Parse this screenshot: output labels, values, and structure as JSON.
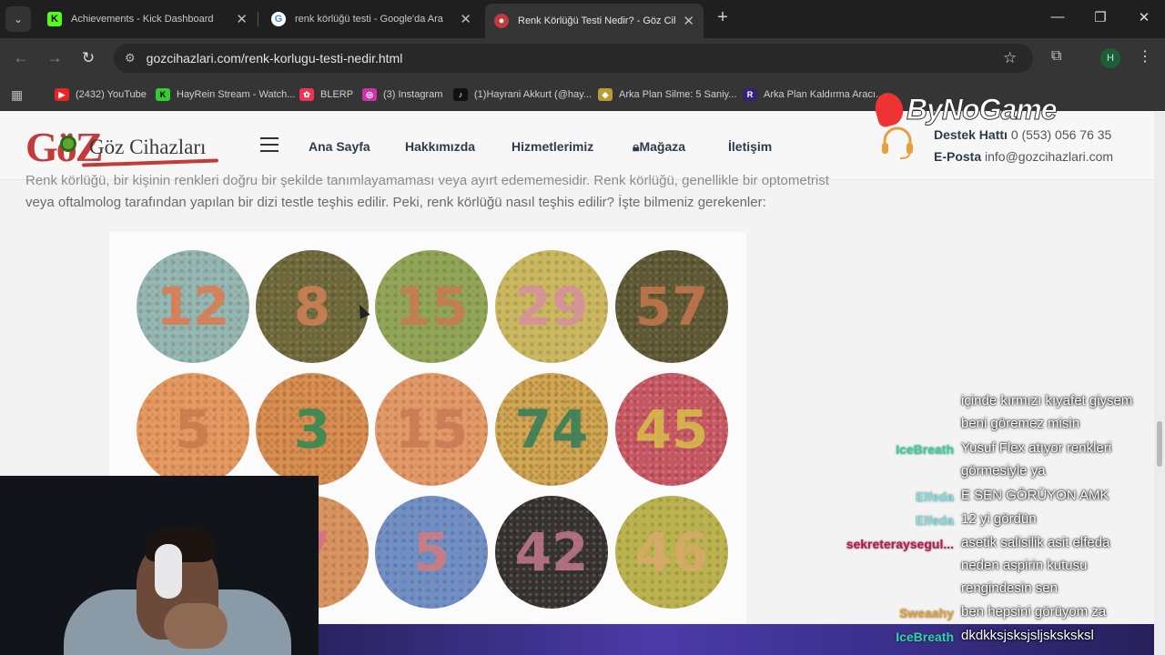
{
  "tabs": [
    {
      "title": "Achievements - Kick Dashboard",
      "icon": "kick-icon"
    },
    {
      "title": "renk körlüğü testi - Google'da Ara",
      "icon": "google-icon"
    },
    {
      "title": "Renk Körlüğü Testi Nedir? - Göz Cihaz",
      "icon": "site-icon",
      "active": true
    }
  ],
  "address": {
    "url": "gozcihazlari.com/renk-korlugu-testi-nedir.html"
  },
  "profile_initial": "H",
  "bookmarks": [
    {
      "label": "(2432) YouTube",
      "icon": "youtube-icon",
      "color": "#e22"
    },
    {
      "label": "HayRein Stream - Watch...",
      "icon": "kick-icon",
      "color": "#3c3"
    },
    {
      "label": "BLERP",
      "icon": "blerp-icon",
      "color": "#e35"
    },
    {
      "label": "(3) Instagram",
      "icon": "instagram-icon",
      "color": "#c3a"
    },
    {
      "label": "(1)Hayrani Akkurt (@hay...",
      "icon": "tiktok-icon",
      "color": "#111"
    },
    {
      "label": "Arka Plan Silme: 5 Saniy...",
      "icon": "removebg-icon",
      "color": "#b93"
    },
    {
      "label": "Arka Plan Kaldırma Aracı...",
      "icon": "remove-tool-icon",
      "color": "#327"
    }
  ],
  "site": {
    "logo_goz": "GöZ",
    "logo_word": "Göz Cihazları",
    "nav": [
      "Ana Sayfa",
      "Hakkımızda",
      "Hizmetlerimiz",
      "Mağaza",
      "İletişim"
    ],
    "support_label": "Destek Hattı",
    "support_phone": "0 (553) 056 76 35",
    "email_label": "E-Posta",
    "email": "info@gozcihazlari.com"
  },
  "article": {
    "line1": "Renk körlüğü, bir kişinin renkleri doğru bir şekilde tanımlayamaması veya ayırt edememesidir. Renk körlüğü, genellikle bir optometrist",
    "line2": "veya oftalmolog tarafından yapılan bir dizi testle teşhis edilir. Peki, renk körlüğü nasıl teşhis edilir? İşte bilmeniz gerekenler:"
  },
  "plates": [
    {
      "num": "12",
      "bg": "#8fbab7",
      "fg": "#e0794d"
    },
    {
      "num": "8",
      "bg": "#6b6a3c",
      "fg": "#d28057"
    },
    {
      "num": "15",
      "bg": "#8da857",
      "fg": "#c97a50"
    },
    {
      "num": "29",
      "bg": "#c9ba5c",
      "fg": "#d88fa0"
    },
    {
      "num": "57",
      "bg": "#5a5a36",
      "fg": "#c7774d"
    },
    {
      "num": "5",
      "bg": "#e69a62",
      "fg": "#c57c4c"
    },
    {
      "num": "3",
      "bg": "#e28b4f",
      "fg": "#2b8a54"
    },
    {
      "num": "15",
      "bg": "#e49a67",
      "fg": "#c87a55"
    },
    {
      "num": "74",
      "bg": "#d7a44f",
      "fg": "#2e7d5a"
    },
    {
      "num": "45",
      "bg": "#c85468",
      "fg": "#d8c04a"
    },
    {
      "num": "",
      "bg": "#e4a06a",
      "fg": "#c57c4c"
    },
    {
      "num": "7",
      "bg": "#d8965c",
      "fg": "#d66e88"
    },
    {
      "num": "5",
      "bg": "#6a90c9",
      "fg": "#d57b7b"
    },
    {
      "num": "42",
      "bg": "#333330",
      "fg": "#c3798b"
    },
    {
      "num": "46",
      "bg": "#b9b34d",
      "fg": "#d9a86a"
    }
  ],
  "watermark": "ByNoGame",
  "chat": [
    {
      "user": "",
      "color": "#fff",
      "lines": [
        "içinde kırmızı kıyafet giysem",
        "beni göremez misin"
      ]
    },
    {
      "user": "IceBreath",
      "color": "#2fd7a7",
      "lines": [
        "Yusuf Flex atıyor renkleri",
        "görmesiyle ya"
      ]
    },
    {
      "user": "Elfeda",
      "color": "#7fe1e0",
      "lines": [
        "E SEN GÖRÜYON AMK"
      ]
    },
    {
      "user": "Elfeda",
      "color": "#7fe1e0",
      "lines": [
        "12 yi gördün"
      ]
    },
    {
      "user": "sekreteraysegul...",
      "color": "#c01650",
      "lines": [
        "asetik salisilik asit elfeda",
        "neden aspirin kutusu",
        "rengindesin sen"
      ]
    },
    {
      "user": "Sweaahy",
      "color": "#e9a334",
      "lines": [
        "ben hepsini görüyom za"
      ]
    },
    {
      "user": "IceBreath",
      "color": "#2fd7a7",
      "lines": [
        "dkdkksjsksjsljsksksksl"
      ]
    }
  ]
}
